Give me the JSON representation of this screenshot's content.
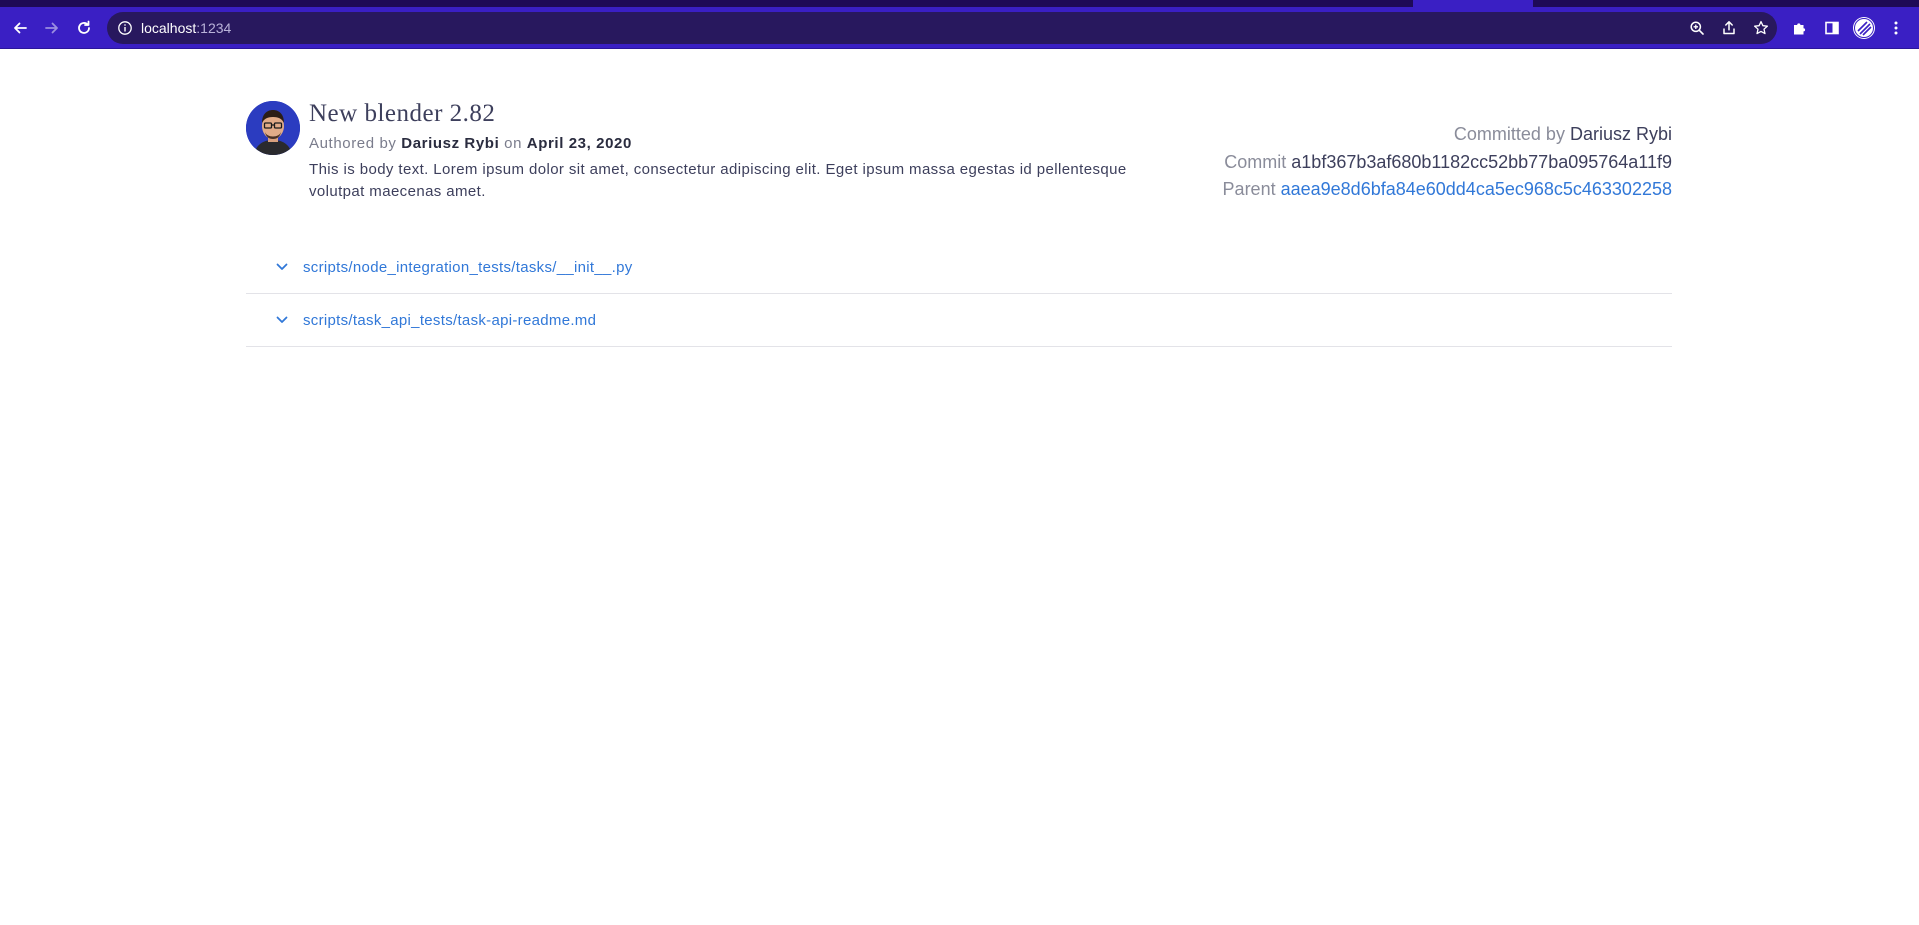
{
  "browser": {
    "url_host": "localhost",
    "url_port": ":1234"
  },
  "commit": {
    "title": "New blender 2.82",
    "authored_prefix": "Authored by",
    "author_name": "Dariusz Rybi",
    "on_word": "on",
    "date": "April 23, 2020",
    "body": "This is body text. Lorem ipsum dolor sit amet, consectetur adipiscing elit. Eget ipsum massa egestas id pellentesque volutpat maecenas amet.",
    "committed_label": "Committed by",
    "committer_name": "Dariusz Rybi",
    "commit_label": "Commit",
    "commit_hash": "a1bf367b3af680b1182cc52bb77ba095764a11f9",
    "parent_label": "Parent",
    "parent_hash": "aaea9e8d6bfa84e60dd4ca5ec968c5c463302258"
  },
  "files": [
    {
      "path": "scripts/node_integration_tests/tasks/__init__.py"
    },
    {
      "path": "scripts/task_api_tests/task-api-readme.md"
    }
  ],
  "icons": {
    "back": "arrow-left-icon",
    "forward": "arrow-right-icon",
    "reload": "reload-icon",
    "info": "info-icon",
    "zoom": "zoom-icon",
    "share": "share-icon",
    "bookmark": "star-icon",
    "extensions": "puzzle-icon",
    "sidepanel": "side-panel-icon",
    "menu": "kebab-menu-icon",
    "expand": "chevron-down-icon"
  },
  "colors": {
    "browser_frame": "#3a1fc4",
    "omnibox": "#28185e",
    "link": "#3178d8",
    "title_text": "#3d3f5c",
    "muted_text": "#7a7c8c"
  }
}
